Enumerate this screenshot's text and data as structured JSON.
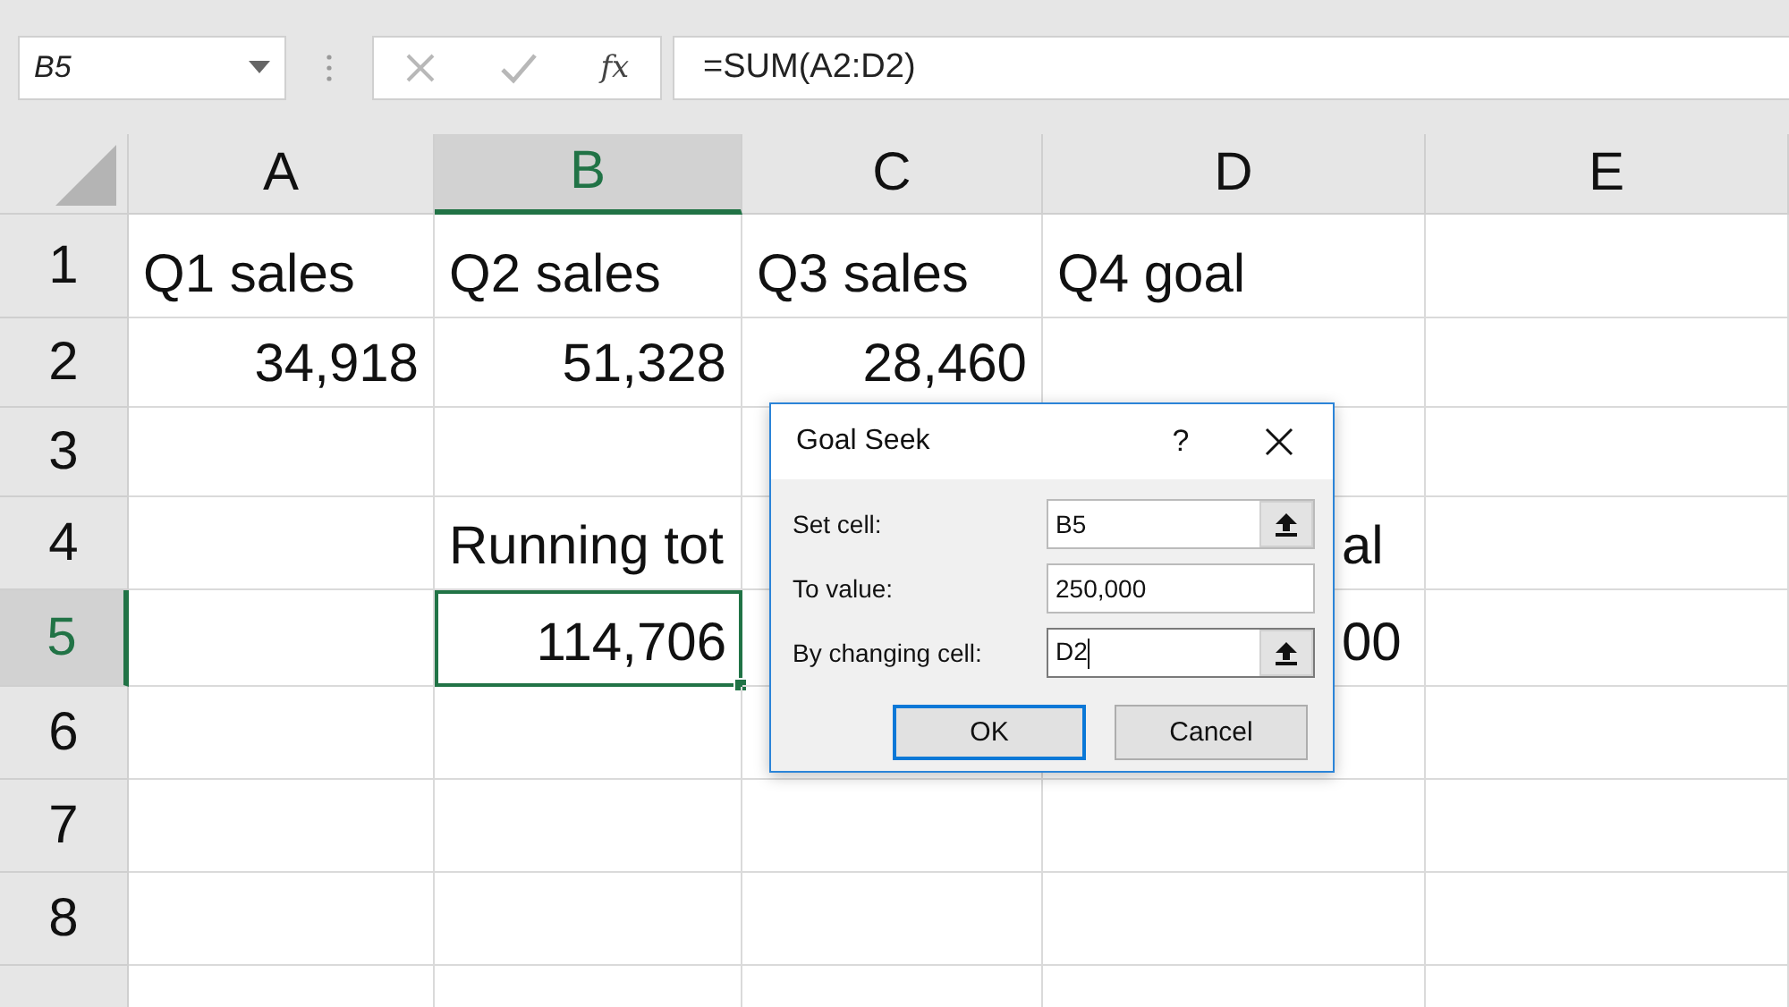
{
  "formula_bar": {
    "name_box": "B5",
    "function_button": "fx",
    "formula": "=SUM(A2:D2)"
  },
  "sheet": {
    "columns": [
      {
        "label": "A",
        "selected": false
      },
      {
        "label": "B",
        "selected": true
      },
      {
        "label": "C",
        "selected": false
      },
      {
        "label": "D",
        "selected": false
      },
      {
        "label": "E",
        "selected": false
      }
    ],
    "rows": [
      {
        "header": "1",
        "selected": false,
        "cells": [
          {
            "text": "Q1 sales",
            "kind": "text",
            "selected": false
          },
          {
            "text": "Q2 sales",
            "kind": "text",
            "selected": false
          },
          {
            "text": "Q3 sales",
            "kind": "text",
            "selected": false
          },
          {
            "text": "Q4 goal",
            "kind": "text",
            "selected": false
          },
          {
            "selected": false
          }
        ]
      },
      {
        "header": "2",
        "selected": false,
        "cells": [
          {
            "text": "34,918",
            "kind": "number",
            "selected": false
          },
          {
            "text": "51,328",
            "kind": "number",
            "selected": false
          },
          {
            "text": "28,460",
            "kind": "number",
            "selected": false
          },
          {
            "selected": false
          },
          {
            "selected": false
          }
        ]
      },
      {
        "header": "3",
        "selected": false,
        "cells": [
          {
            "selected": false
          },
          {
            "selected": false
          },
          {
            "selected": false
          },
          {
            "selected": false
          },
          {
            "selected": false
          }
        ]
      },
      {
        "header": "4",
        "selected": false,
        "cells": [
          {
            "selected": false
          },
          {
            "text": "Running tot",
            "kind": "text",
            "selected": false
          },
          {
            "selected": false
          },
          {
            "text": "al",
            "kind": "partial",
            "selected": false
          },
          {
            "selected": false
          }
        ]
      },
      {
        "header": "5",
        "selected": true,
        "cells": [
          {
            "selected": false
          },
          {
            "text": "114,706",
            "kind": "number",
            "selected": true
          },
          {
            "selected": false
          },
          {
            "text": "00",
            "kind": "partial",
            "selected": false
          },
          {
            "selected": false
          }
        ]
      },
      {
        "header": "6",
        "selected": false,
        "cells": [
          {
            "selected": false
          },
          {
            "selected": false
          },
          {
            "selected": false
          },
          {
            "selected": false
          },
          {
            "selected": false
          }
        ]
      },
      {
        "header": "7",
        "selected": false,
        "cells": [
          {
            "selected": false
          },
          {
            "selected": false
          },
          {
            "selected": false
          },
          {
            "selected": false
          },
          {
            "selected": false
          }
        ]
      },
      {
        "header": "8",
        "selected": false,
        "cells": [
          {
            "selected": false
          },
          {
            "selected": false
          },
          {
            "selected": false
          },
          {
            "selected": false
          },
          {
            "selected": false
          }
        ]
      }
    ]
  },
  "dialog": {
    "title": "Goal Seek",
    "help": "?",
    "fields": [
      {
        "label": "Set cell:",
        "value": "B5",
        "picker": true,
        "focused": false
      },
      {
        "label": "To value:",
        "value": "250,000",
        "picker": false,
        "focused": false
      },
      {
        "label": "By changing cell:",
        "value": "D2",
        "picker": true,
        "focused": true
      }
    ],
    "buttons": [
      {
        "label": "OK",
        "default": true
      },
      {
        "label": "Cancel",
        "default": false
      }
    ]
  }
}
